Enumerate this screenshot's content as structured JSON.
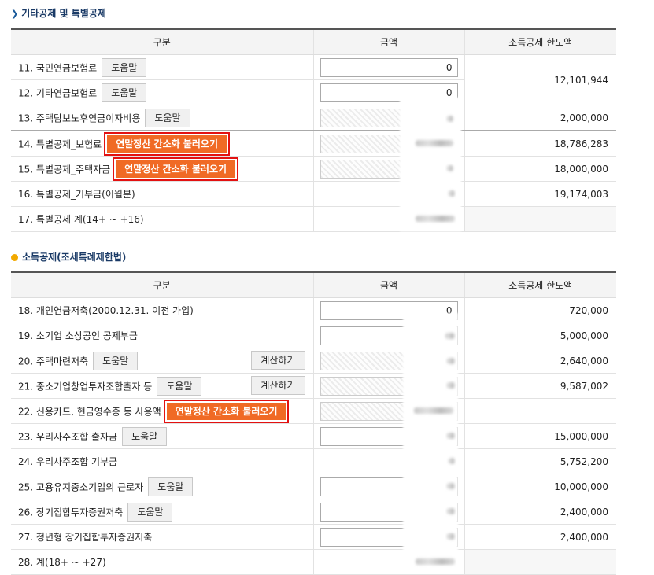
{
  "section1": {
    "title": "기타공제 및 특별공제",
    "headers": [
      "구분",
      "금액",
      "소득공제 한도액"
    ],
    "help_label": "도움말",
    "fetch_label": "연말정산 간소화 불러오기",
    "rows": {
      "r11": {
        "label": "11. 국민연금보험료",
        "amount": "0"
      },
      "r12": {
        "label": "12. 기타연금보험료",
        "amount": "0"
      },
      "r1112_limit": "12,101,944",
      "r13": {
        "label": "13. 주택담보노후연금이자비용",
        "limit": "2,000,000"
      },
      "r14": {
        "label": "14. 특별공제_보험료",
        "limit": "18,786,283"
      },
      "r15": {
        "label": "15. 특별공제_주택자금",
        "limit": "18,000,000"
      },
      "r16": {
        "label": "16. 특별공제_기부금(이월분)",
        "limit": "19,174,003"
      },
      "r17": {
        "label": "17. 특별공제 계(14+ ~ +16)"
      }
    }
  },
  "section2": {
    "title": "소득공제(조세특례제한법)",
    "headers": [
      "구분",
      "금액",
      "소득공제 한도액"
    ],
    "help_label": "도움말",
    "calc_label": "계산하기",
    "fetch_label": "연말정산 간소화 불러오기",
    "rows": {
      "r18": {
        "label": "18. 개인연금저축(2000.12.31. 이전 가입)",
        "amount": "0",
        "limit": "720,000"
      },
      "r19": {
        "label": "19. 소기업 소상공인 공제부금",
        "limit": "5,000,000"
      },
      "r20": {
        "label": "20. 주택마련저축",
        "limit": "2,640,000"
      },
      "r21": {
        "label": "21. 중소기업창업투자조합출자 등",
        "limit": "9,587,002"
      },
      "r22": {
        "label": "22. 신용카드, 현금영수증 등 사용액"
      },
      "r23": {
        "label": "23. 우리사주조합 출자금",
        "limit": "15,000,000"
      },
      "r24": {
        "label": "24. 우리사주조합 기부금",
        "limit": "5,752,200"
      },
      "r25": {
        "label": "25. 고용유지중소기업의 근로자",
        "limit": "10,000,000"
      },
      "r26": {
        "label": "26. 장기집합투자증권저축",
        "limit": "2,400,000"
      },
      "r27": {
        "label": "27. 청년형 장기집합투자증권저축",
        "limit": "2,400,000"
      },
      "r28": {
        "label": "28. 계(18+ ~ +27)"
      }
    }
  }
}
